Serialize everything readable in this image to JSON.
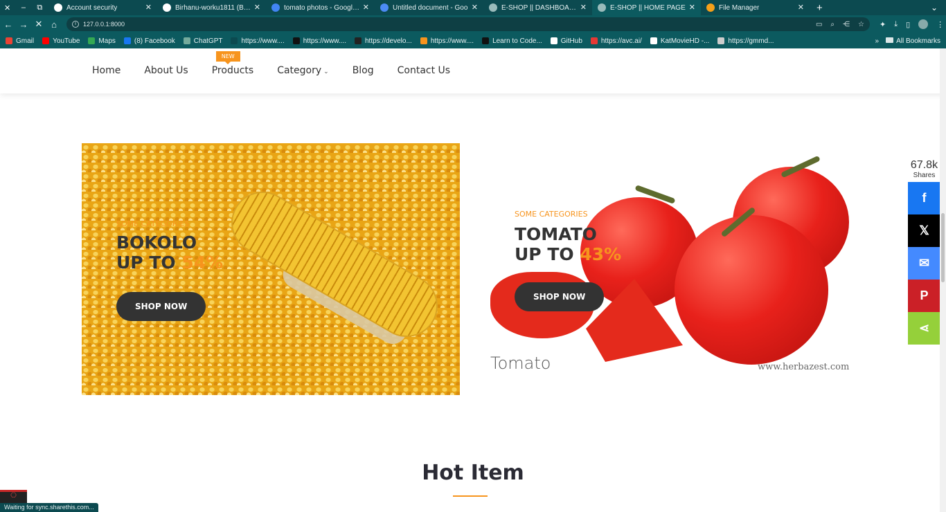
{
  "browser": {
    "tabs": [
      {
        "title": "Account security",
        "fav": "#ffffff",
        "icon": "github-icon"
      },
      {
        "title": "Birhanu-worku1811 (Birh",
        "fav": "#ffffff",
        "icon": "github-icon"
      },
      {
        "title": "tomato photos - Google S",
        "fav": "#4285f4",
        "icon": "google-icon"
      },
      {
        "title": "Untitled document - Goo",
        "fav": "#4c8bf5",
        "icon": "docs-icon"
      },
      {
        "title": "E-SHOP || DASHBOARD",
        "fav": "#9bb",
        "icon": "globe-icon"
      },
      {
        "title": "E-SHOP || HOME PAGE",
        "fav": "#9bb",
        "icon": "globe-icon",
        "active": true
      },
      {
        "title": "File Manager",
        "fav": "#f6a019",
        "icon": "file-manager-icon"
      }
    ],
    "url": "127.0.0.1:8000",
    "bookmarks": [
      {
        "label": "Gmail",
        "color": "#ea4335"
      },
      {
        "label": "YouTube",
        "color": "#ff0000"
      },
      {
        "label": "Maps",
        "color": "#34a853"
      },
      {
        "label": "(8) Facebook",
        "color": "#1877f2"
      },
      {
        "label": "ChatGPT",
        "color": "#74aa9c"
      },
      {
        "label": "https://www....",
        "color": "#0c4a50"
      },
      {
        "label": "https://www....",
        "color": "#111111"
      },
      {
        "label": "https://develo...",
        "color": "#222222"
      },
      {
        "label": "https://www....",
        "color": "#f7941d"
      },
      {
        "label": "Learn to Code...",
        "color": "#111111"
      },
      {
        "label": "GitHub",
        "color": "#ffffff"
      },
      {
        "label": "https://avc.ai/",
        "color": "#e53935"
      },
      {
        "label": "KatMovieHD -...",
        "color": "#ffffff"
      },
      {
        "label": "https://gmmd...",
        "color": "#cccccc"
      }
    ],
    "all_bookmarks": "All Bookmarks",
    "status": "Waiting for sync.sharethis.com..."
  },
  "nav": {
    "items": [
      "Home",
      "About Us",
      "Products",
      "Category",
      "Blog",
      "Contact Us"
    ],
    "new_badge": "NEW"
  },
  "banner_corn": {
    "subtitle": "SOME CATEGORIES",
    "line1": "BOKOLO",
    "line2": "UP TO",
    "percent": "54%",
    "button": "SHOP NOW"
  },
  "banner_tomato": {
    "subtitle": "SOME CATEGORIES",
    "line1": "TOMATO",
    "line2": "UP TO",
    "percent": "43%",
    "button": "SHOP NOW",
    "caption": "Tomato",
    "url": "www.herbazest.com"
  },
  "section": {
    "title": "Hot Item"
  },
  "share": {
    "count": "67.8k",
    "label": "Shares",
    "buttons": [
      {
        "name": "facebook-share-button",
        "icon": "facebook-icon",
        "glyph": "f",
        "color": "#1877f2"
      },
      {
        "name": "x-share-button",
        "icon": "x-icon",
        "glyph": "𝕏",
        "color": "#000000"
      },
      {
        "name": "messenger-share-button",
        "icon": "messenger-icon",
        "glyph": "✉",
        "color": "#448aff"
      },
      {
        "name": "pinterest-share-button",
        "icon": "pinterest-icon",
        "glyph": "P",
        "color": "#cb2027"
      },
      {
        "name": "sharethis-share-button",
        "icon": "share-icon",
        "glyph": "⋖",
        "color": "#95d03a"
      }
    ]
  },
  "colors": {
    "accent": "#f7941d",
    "dark": "#333333"
  }
}
